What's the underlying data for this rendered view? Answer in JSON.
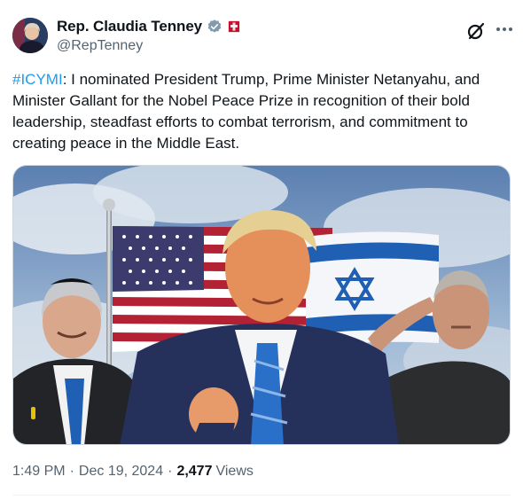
{
  "author": {
    "display_name": "Rep. Claudia Tenney",
    "handle": "@RepTenney",
    "verified_color": "#829aab",
    "affiliation_color": "#c8102e"
  },
  "tweet": {
    "hashtag": "#ICYMI",
    "body": ": I nominated President Trump, Prime Minister Netanyahu, and Minister Gallant for the Nobel Peace Prize in recognition of their bold leadership, steadfast efforts to combat terrorism, and commitment to creating peace in the Middle East."
  },
  "meta": {
    "time": "1:49 PM",
    "date": "Dec 19, 2024",
    "views_count": "2,477",
    "views_label": "Views"
  },
  "icons": {
    "grok": "grok-icon",
    "more": "more-icon",
    "verified": "verified-badge-icon",
    "affiliation": "affiliation-badge-icon"
  },
  "colors": {
    "link": "#1d9bf0",
    "secondary_text": "#536471",
    "primary_text": "#0f1419"
  }
}
